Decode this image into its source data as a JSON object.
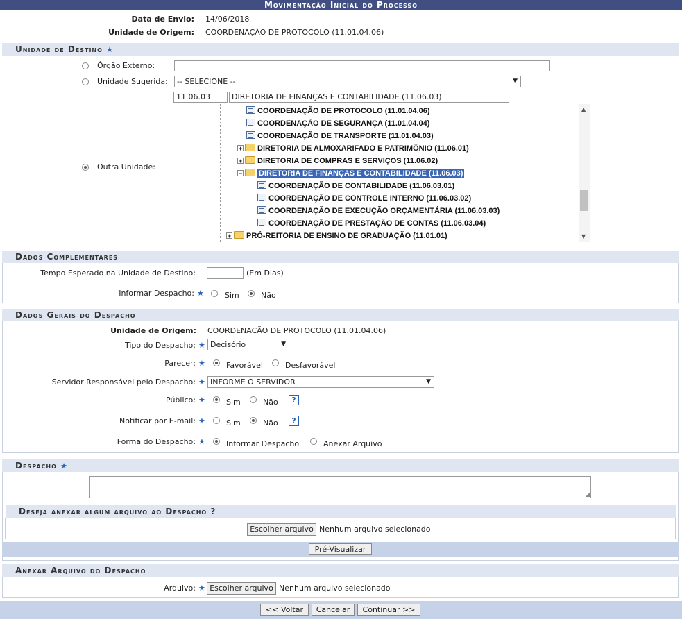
{
  "header": {
    "title": "Movimentação Inicial do Processo"
  },
  "info": {
    "data_envio_label": "Data de Envio:",
    "data_envio_value": "14/06/2018",
    "unidade_origem_label": "Unidade de Origem:",
    "unidade_origem_value": "COORDENAÇÃO DE PROTOCOLO (11.01.04.06)"
  },
  "destino": {
    "title": "Unidade de Destino",
    "orgao_externo_label": "Órgão Externo:",
    "unidade_sugerida_label": "Unidade Sugerida:",
    "unidade_sugerida_value": "-- SELECIONE --",
    "outra_unidade_label": "Outra Unidade:",
    "codigo_value": "11.06.03",
    "nome_value": "DIRETORIA DE FINANÇAS E CONTABILIDADE (11.06.03)",
    "tree": [
      {
        "label": "COORDENAÇÃO DE PROTOCOLO (11.01.04.06)"
      },
      {
        "label": "COORDENAÇÃO DE SEGURANÇA (11.01.04.04)"
      },
      {
        "label": "COORDENAÇÃO DE TRANSPORTE (11.01.04.03)"
      },
      {
        "label": "DIRETORIA DE ALMOXARIFADO E PATRIMÔNIO (11.06.01)"
      },
      {
        "label": "DIRETORIA DE COMPRAS E SERVIÇOS (11.06.02)"
      },
      {
        "label": "DIRETORIA DE FINANÇAS E CONTABILIDADE (11.06.03)"
      },
      {
        "label": "COORDENAÇÃO DE CONTABILIDADE (11.06.03.01)"
      },
      {
        "label": "COORDENAÇÃO DE CONTROLE INTERNO (11.06.03.02)"
      },
      {
        "label": "COORDENAÇÃO DE EXECUÇÃO ORÇAMENTÁRIA (11.06.03.03)"
      },
      {
        "label": "COORDENAÇÃO DE PRESTAÇÃO DE CONTAS (11.06.03.04)"
      },
      {
        "label": "PRÓ-REITORIA DE ENSINO DE GRADUAÇÃO (11.01.01)"
      }
    ]
  },
  "complementares": {
    "title": "Dados Complementares",
    "tempo_label": "Tempo Esperado na Unidade de Destino:",
    "tempo_unit": "(Em Dias)",
    "informar_label": "Informar Despacho:",
    "sim": "Sim",
    "nao": "Não"
  },
  "gerais": {
    "title": "Dados Gerais do Despacho",
    "origem_label": "Unidade de Origem:",
    "origem_value": "COORDENAÇÃO DE PROTOCOLO (11.01.04.06)",
    "tipo_label": "Tipo do Despacho:",
    "tipo_value": "Decisório",
    "parecer_label": "Parecer:",
    "favoravel": "Favorável",
    "desfavoravel": "Desfavorável",
    "servidor_label": "Servidor Responsável pelo Despacho:",
    "servidor_value": "INFORME O SERVIDOR",
    "publico_label": "Público:",
    "notificar_label": "Notificar por E-mail:",
    "sim": "Sim",
    "nao": "Não",
    "help": "?",
    "forma_label": "Forma do Despacho:",
    "informar_despacho": "Informar Despacho",
    "anexar_arquivo": "Anexar Arquivo"
  },
  "despacho": {
    "title": "Despacho",
    "anexar_question": "Deseja anexar algum arquivo ao Despacho ?",
    "escolher": "Escolher arquivo",
    "nenhum": "Nenhum arquivo selecionado",
    "pre_visualizar": "Pré-Visualizar"
  },
  "anexo": {
    "title": "Anexar Arquivo do Despacho",
    "arquivo_label": "Arquivo:",
    "escolher": "Escolher arquivo",
    "nenhum": "Nenhum arquivo selecionado"
  },
  "footer": {
    "voltar": "<< Voltar",
    "cancelar": "Cancelar",
    "continuar": "Continuar >>"
  }
}
